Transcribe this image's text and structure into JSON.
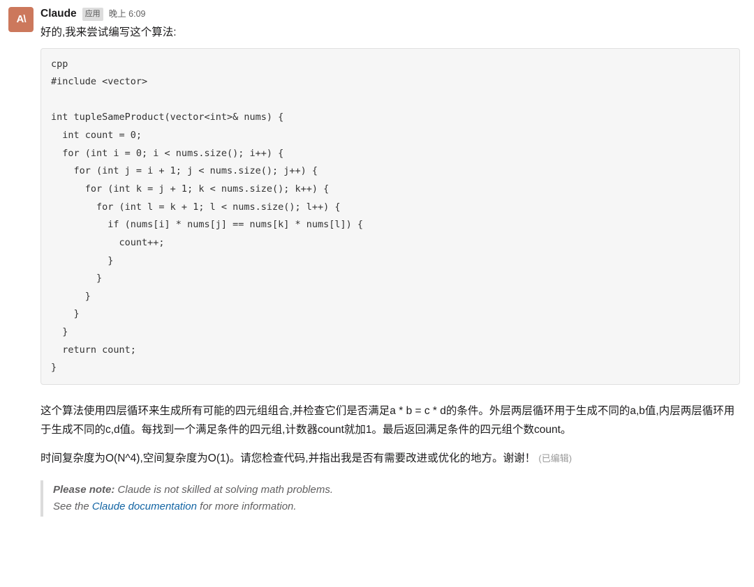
{
  "message": {
    "avatar_text": "A\\",
    "sender": "Claude",
    "app_badge": "应用",
    "timestamp": "晚上 6:09",
    "intro": "好的,我来尝试编写这个算法:",
    "code": "cpp\n#include <vector>\n\nint tupleSameProduct(vector<int>& nums) {\n  int count = 0;\n  for (int i = 0; i < nums.size(); i++) {\n    for (int j = i + 1; j < nums.size(); j++) {\n      for (int k = j + 1; k < nums.size(); k++) {\n        for (int l = k + 1; l < nums.size(); l++) {\n          if (nums[i] * nums[j] == nums[k] * nums[l]) {\n            count++;\n          }\n        }\n      }\n    }\n  }\n  return count;\n}",
    "paragraph1": "这个算法使用四层循环来生成所有可能的四元组组合,并检查它们是否满足a * b = c * d的条件。外层两层循环用于生成不同的a,b值,内层两层循环用于生成不同的c,d值。每找到一个满足条件的四元组,计数器count就加1。最后返回满足条件的四元组个数count。",
    "paragraph2_main": "时间复杂度为O(N^4),空间复杂度为O(1)。请您检查代码,并指出我是否有需要改进或优化的地方。谢谢！",
    "edited_label": "(已编辑)",
    "note_lead": "Please note:",
    "note_line1_rest": " Claude is not skilled at solving math problems.",
    "note_line2_a": "See the ",
    "note_link": "Claude documentation",
    "note_line2_b": " for more information."
  }
}
